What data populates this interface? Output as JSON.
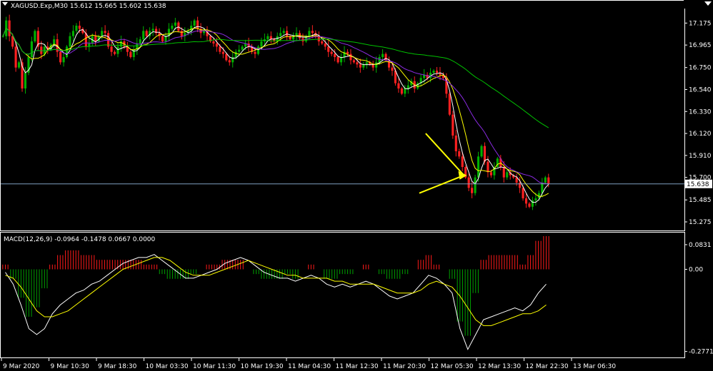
{
  "colors": {
    "background": "#000000",
    "frame": "#ffffff",
    "bull_candle": "#00b000",
    "bear_candle": "#ff2020",
    "ma_fast": "#ffffff",
    "ma_mid": "#ffff00",
    "ma_slow": "#8a2be2",
    "ma_long": "#00c000",
    "macd_hist_pos": "#ff1a1a",
    "macd_hist_neg": "#00a000",
    "macd_main": "#ffffff",
    "macd_signal": "#ffff00",
    "arrow": "#ffff00",
    "current_price_line": "#7f9fbf",
    "price_box_bg": "#ffffff",
    "price_box_text": "#000000"
  },
  "chart_data": [
    {
      "type": "candlestick",
      "title": "XAGUSD.Exp,M30  15.612 15.665 15.602 15.638",
      "y_ticks": [
        "17.175",
        "16.965",
        "16.750",
        "16.540",
        "16.330",
        "16.120",
        "15.910",
        "15.700",
        "15.485",
        "15.275"
      ],
      "ylim": [
        15.2,
        17.3
      ],
      "current_price": "15.638",
      "x_ticks": [
        "9 Mar 2020",
        "9 Mar 10:30",
        "9 Mar 18:30",
        "10 Mar 03:30",
        "10 Mar 11:30",
        "10 Mar 19:30",
        "11 Mar 04:30",
        "11 Mar 12:30",
        "11 Mar 20:30",
        "12 Mar 05:30",
        "12 Mar 13:30",
        "12 Mar 22:30",
        "13 Mar 06:30"
      ],
      "close_series": [
        17.05,
        17.2,
        17.05,
        16.95,
        16.75,
        16.8,
        16.55,
        16.7,
        16.85,
        17.0,
        17.1,
        16.95,
        16.88,
        16.95,
        16.92,
        16.97,
        17.02,
        16.9,
        16.8,
        16.85,
        16.95,
        17.05,
        17.1,
        17.15,
        17.12,
        17.08,
        16.95,
        16.98,
        17.05,
        17.0,
        17.05,
        17.1,
        17.08,
        16.95,
        16.9,
        16.88,
        16.95,
        17.0,
        16.95,
        16.9,
        16.85,
        16.92,
        16.98,
        17.02,
        17.1,
        17.05,
        17.1,
        17.12,
        17.08,
        17.05,
        17.0,
        17.05,
        17.12,
        17.15,
        17.18,
        17.1,
        17.05,
        17.08,
        17.1,
        17.15,
        17.2,
        17.12,
        17.08,
        17.1,
        17.05,
        17.0,
        16.98,
        16.95,
        16.9,
        16.88,
        16.82,
        16.8,
        16.85,
        16.9,
        16.92,
        16.95,
        16.98,
        16.95,
        16.9,
        16.88,
        16.95,
        17.0,
        17.02,
        17.05,
        17.02,
        17.0,
        17.05,
        17.08,
        17.1,
        17.05,
        17.02,
        17.05,
        17.08,
        17.03,
        17.0,
        17.05,
        17.1,
        17.08,
        17.05,
        17.0,
        16.98,
        16.95,
        16.9,
        16.88,
        16.85,
        16.8,
        16.85,
        16.9,
        16.88,
        16.82,
        16.8,
        16.78,
        16.75,
        16.78,
        16.8,
        16.78,
        16.75,
        16.8,
        16.85,
        16.88,
        16.82,
        16.75,
        16.72,
        16.6,
        16.55,
        16.5,
        16.55,
        16.58,
        16.62,
        16.55,
        16.6,
        16.65,
        16.68,
        16.65,
        16.7,
        16.72,
        16.7,
        16.68,
        16.65,
        16.5,
        16.3,
        16.1,
        15.95,
        15.9,
        15.8,
        15.7,
        15.6,
        15.55,
        15.7,
        15.9,
        16.0,
        15.85,
        15.75,
        15.72,
        15.8,
        15.88,
        15.8,
        15.7,
        15.75,
        15.72,
        15.7,
        15.65,
        15.6,
        15.5,
        15.45,
        15.42,
        15.48,
        15.5,
        15.55,
        15.65,
        15.7,
        15.638
      ],
      "macd": {
        "label": "MACD(12,26,9) -0.0964 -0.1478 0.0667 0.0000",
        "y_ticks": [
          "0.0831",
          "0.00",
          "-0.2771"
        ],
        "ylim": [
          -0.29,
          0.095
        ],
        "main_series": [
          -0.01,
          -0.05,
          -0.12,
          -0.2,
          -0.22,
          -0.2,
          -0.15,
          -0.12,
          -0.1,
          -0.08,
          -0.07,
          -0.05,
          -0.04,
          -0.02,
          0.0,
          0.02,
          0.03,
          0.04,
          0.04,
          0.05,
          0.03,
          0.01,
          -0.01,
          -0.03,
          -0.03,
          -0.02,
          -0.01,
          0.0,
          0.02,
          0.03,
          0.04,
          0.03,
          0.01,
          -0.01,
          -0.02,
          -0.03,
          -0.03,
          -0.04,
          -0.03,
          -0.02,
          -0.03,
          -0.05,
          -0.06,
          -0.05,
          -0.06,
          -0.05,
          -0.04,
          -0.05,
          -0.07,
          -0.09,
          -0.1,
          -0.09,
          -0.08,
          -0.05,
          -0.02,
          -0.03,
          -0.05,
          -0.08,
          -0.2,
          -0.27,
          -0.22,
          -0.17,
          -0.16,
          -0.15,
          -0.14,
          -0.13,
          -0.14,
          -0.12,
          -0.08,
          -0.05
        ],
        "signal_series": [
          -0.02,
          -0.03,
          -0.06,
          -0.1,
          -0.14,
          -0.16,
          -0.16,
          -0.15,
          -0.14,
          -0.12,
          -0.1,
          -0.08,
          -0.06,
          -0.04,
          -0.02,
          0.0,
          0.01,
          0.02,
          0.03,
          0.04,
          0.04,
          0.03,
          0.01,
          -0.01,
          -0.02,
          -0.02,
          -0.02,
          -0.01,
          0.0,
          0.01,
          0.02,
          0.03,
          0.02,
          0.01,
          0.0,
          -0.01,
          -0.02,
          -0.02,
          -0.03,
          -0.03,
          -0.03,
          -0.03,
          -0.04,
          -0.04,
          -0.05,
          -0.05,
          -0.05,
          -0.05,
          -0.06,
          -0.07,
          -0.08,
          -0.08,
          -0.08,
          -0.07,
          -0.05,
          -0.04,
          -0.05,
          -0.06,
          -0.09,
          -0.13,
          -0.17,
          -0.19,
          -0.19,
          -0.18,
          -0.17,
          -0.16,
          -0.15,
          -0.15,
          -0.14,
          -0.12
        ]
      }
    }
  ]
}
